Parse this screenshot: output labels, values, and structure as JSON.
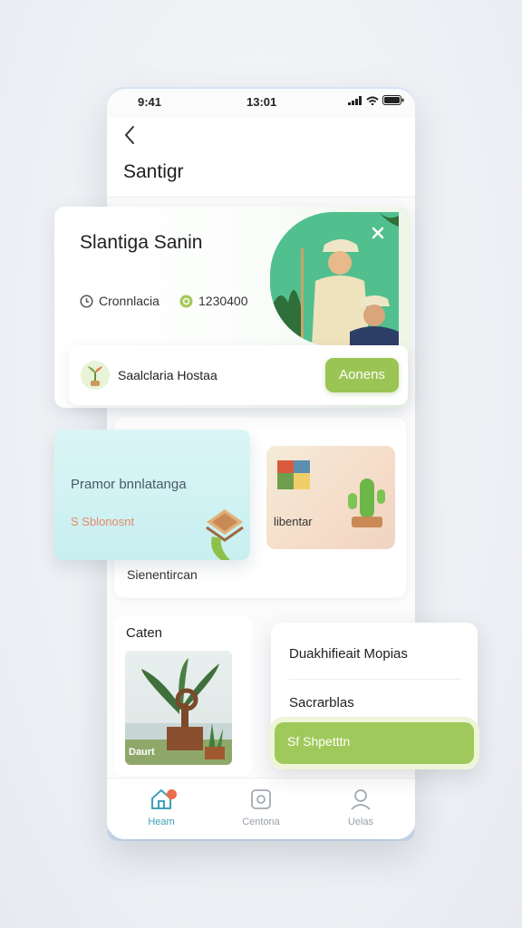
{
  "status": {
    "time_left": "9:41",
    "time_center": "13:01"
  },
  "header": {
    "title": "Santigr"
  },
  "hero": {
    "name": "Slantiga Sanin",
    "stat1": "Cronnlacia",
    "stat2": "1230400"
  },
  "user_row": {
    "name": "Saalclaria Hostaa",
    "action": "Aonens"
  },
  "promo": {
    "title": "Pramor bnnlatanga",
    "subtitle": "S Sblonosnt"
  },
  "tiles": {
    "card_label": "Sienentircan",
    "tile2_label": "libentar"
  },
  "garden": {
    "title": "Caten",
    "caption": "Daurt"
  },
  "popup": {
    "row1": "Duakhifieait Mopias",
    "row2": "Sacrarblas",
    "button": "Sf Shpetttn"
  },
  "tabs": [
    {
      "label": "Heam"
    },
    {
      "label": "Centona"
    },
    {
      "label": "Uelas"
    }
  ],
  "colors": {
    "accent_green": "#9ac454",
    "active_tab": "#3fa0b8",
    "badge": "#ee6b4a"
  }
}
